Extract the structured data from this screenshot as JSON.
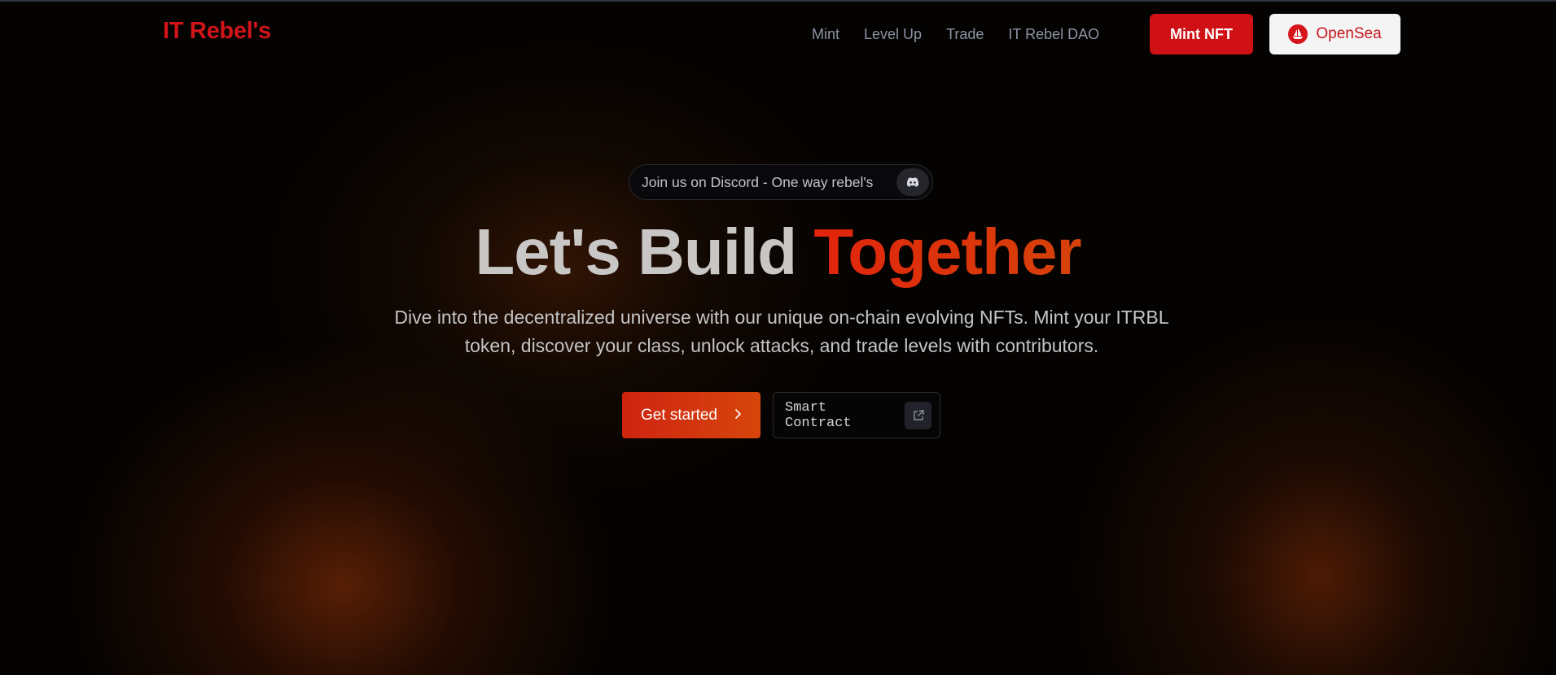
{
  "nav": {
    "brand": "IT Rebel's",
    "links": [
      "Mint",
      "Level Up",
      "Trade",
      "IT Rebel DAO"
    ],
    "mint_button": "Mint NFT",
    "opensea_button": "OpenSea"
  },
  "hero": {
    "discord_pill": "Join us on Discord - One way rebel's",
    "headline_plain": "Let's Build ",
    "headline_accent": "Together",
    "subtitle": "Dive into the decentralized universe with our unique on-chain evolving NFTs. Mint your ITRBL token, discover your class, unlock attacks, and trade levels with contributors.",
    "cta_primary": "Get started",
    "cta_secondary": "Smart Contract"
  },
  "icons": {
    "discord": "discord-icon",
    "opensea": "opensea-icon",
    "chevron": "chevron-right-icon",
    "external": "external-link-icon"
  },
  "colors": {
    "brand_red": "#d1141a",
    "accent_orange": "#d6420a",
    "background": "#050302"
  }
}
